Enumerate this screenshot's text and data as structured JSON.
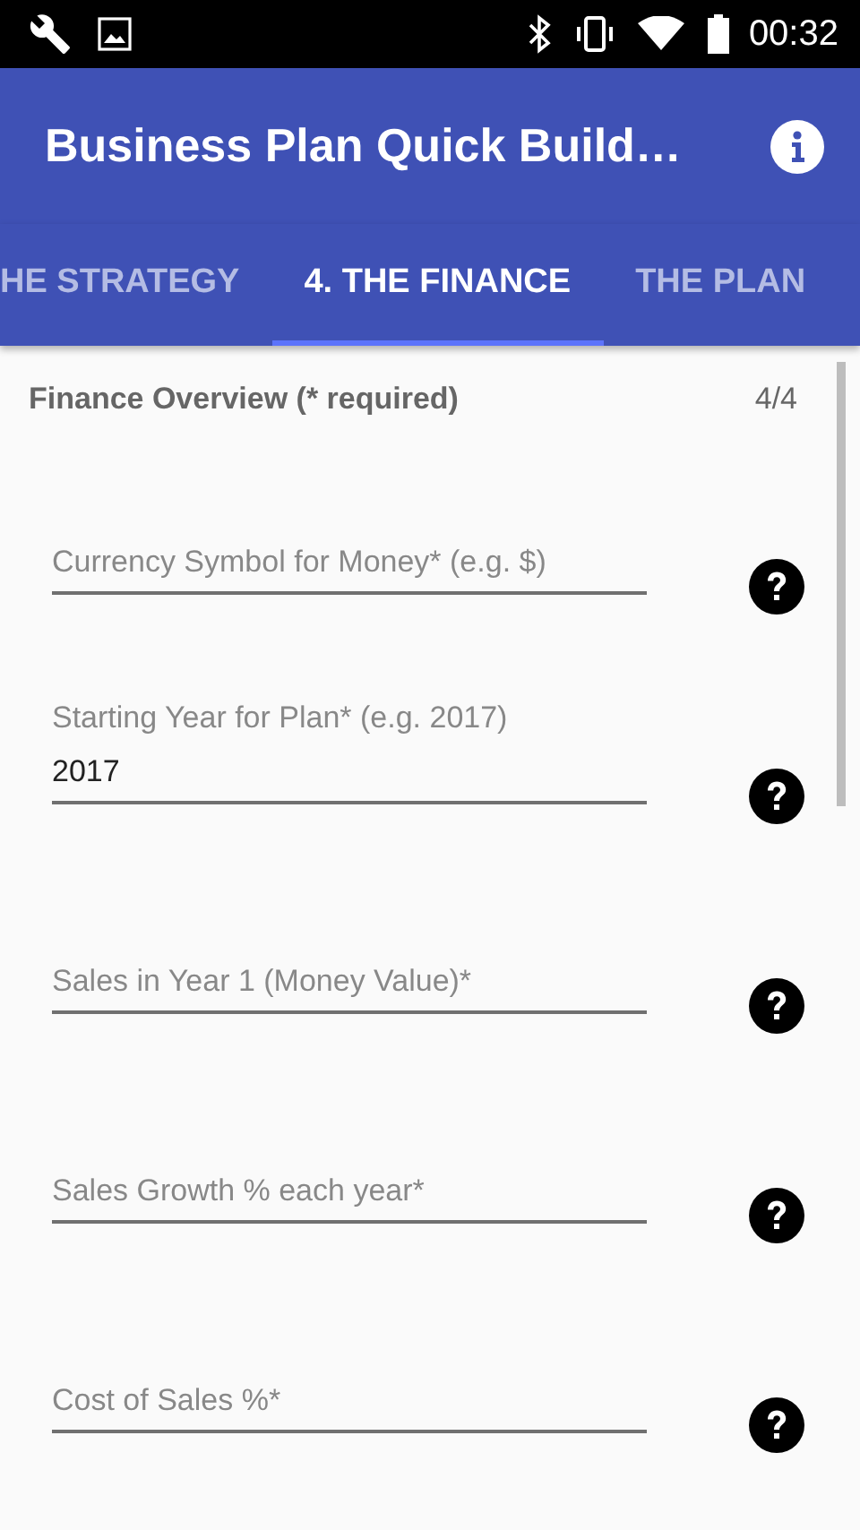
{
  "status_bar": {
    "time": "00:32"
  },
  "app_bar": {
    "title": "Business Plan Quick Build…"
  },
  "tabs": [
    {
      "label": "HE STRATEGY",
      "selected": false
    },
    {
      "label": "4. THE FINANCE",
      "selected": true
    },
    {
      "label": "THE PLAN",
      "selected": false
    }
  ],
  "section": {
    "title": "Finance Overview (* required)",
    "page": "4/4"
  },
  "fields": [
    {
      "placeholder": "Currency Symbol for Money* (e.g. $)"
    },
    {
      "label": "Starting Year for Plan* (e.g. 2017)",
      "value": "2017"
    },
    {
      "placeholder": "Sales in Year 1 (Money Value)*"
    },
    {
      "placeholder": "Sales Growth % each year*"
    },
    {
      "placeholder": "Cost of Sales %*"
    }
  ]
}
